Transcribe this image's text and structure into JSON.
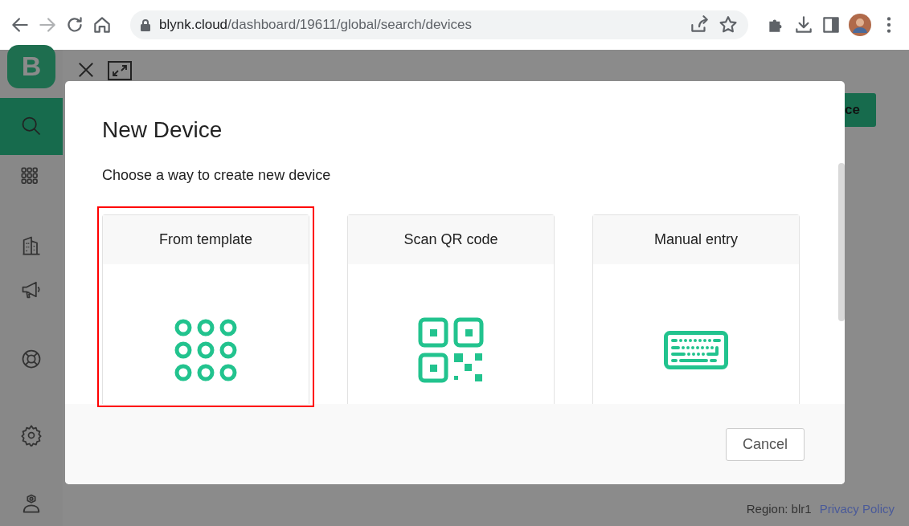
{
  "browser": {
    "url_host": "blynk.cloud",
    "url_path": "/dashboard/19611/global/search/devices"
  },
  "sidebar": {
    "logo": "B",
    "items": [
      {
        "kind": "search",
        "selected": true
      },
      {
        "kind": "grid",
        "selected": false
      },
      {
        "kind": "building",
        "selected": false
      },
      {
        "kind": "megaphone",
        "selected": false
      },
      {
        "kind": "lifebuoy",
        "selected": false
      },
      {
        "kind": "gear",
        "selected": false
      },
      {
        "kind": "user",
        "selected": false
      }
    ]
  },
  "header_button": {
    "label": "ce"
  },
  "dialog": {
    "title": "New Device",
    "subtitle": "Choose a way to create new device",
    "options": [
      {
        "label": "From template",
        "kind": "template",
        "highlighted": true
      },
      {
        "label": "Scan QR code",
        "kind": "qr",
        "highlighted": false
      },
      {
        "label": "Manual entry",
        "kind": "keyboard",
        "highlighted": false
      }
    ],
    "cancel_button": "Cancel"
  },
  "footer": {
    "region": "Region: blr1",
    "link": "Privacy Policy"
  }
}
